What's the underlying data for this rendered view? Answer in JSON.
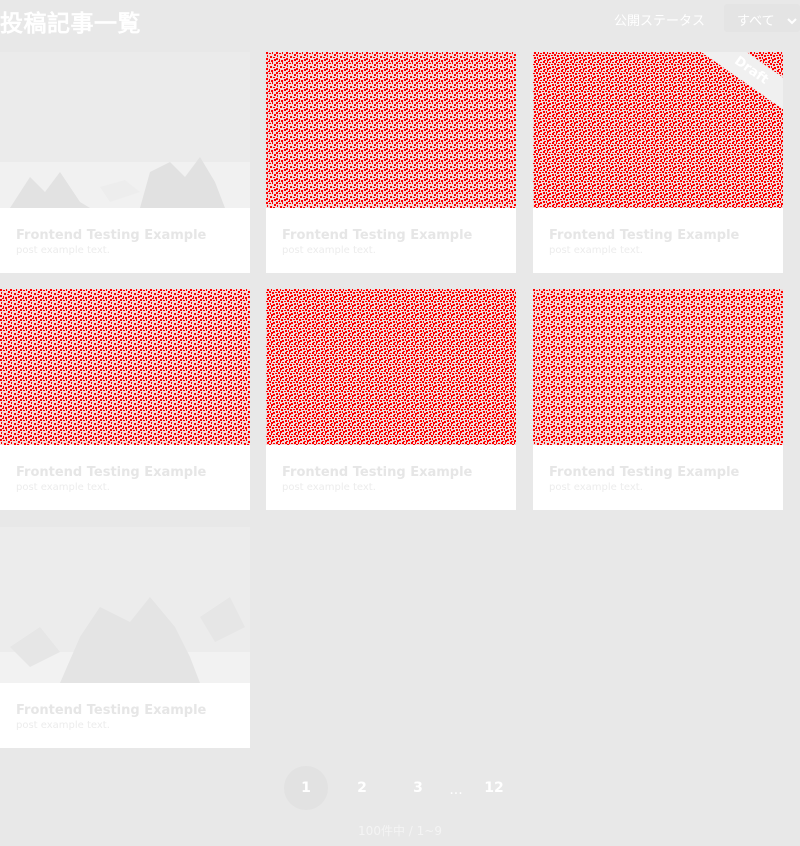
{
  "header": {
    "title": "投稿記事一覧",
    "status_label": "公開ステータス",
    "status_select_value": "すべて"
  },
  "posts": [
    {
      "title": "Frontend Testing Example",
      "excerpt": "post example text.",
      "thumb": "gray-aquarium"
    },
    {
      "title": "Frontend Testing Example",
      "excerpt": "post example text.",
      "thumb": "red-noise"
    },
    {
      "title": "Frontend Testing Example",
      "excerpt": "post example text.",
      "thumb": "red-noise",
      "badge": "Draft"
    },
    {
      "title": "Frontend Testing Example",
      "excerpt": "post example text.",
      "thumb": "red-noise"
    },
    {
      "title": "Frontend Testing Example",
      "excerpt": "post example text.",
      "thumb": "red-noise"
    },
    {
      "title": "Frontend Testing Example",
      "excerpt": "post example text.",
      "thumb": "red-noise"
    },
    {
      "title": "Frontend Testing Example",
      "excerpt": "post example text.",
      "thumb": "gray-plants"
    }
  ],
  "pagination": {
    "pages": [
      "1",
      "2",
      "3"
    ],
    "ellipsis": "...",
    "last": "12",
    "current": "1"
  },
  "summary": "100件中 / 1~9",
  "colors": {
    "background": "#e8e8e8",
    "card": "#ffffff",
    "noise": "#ff0000"
  }
}
